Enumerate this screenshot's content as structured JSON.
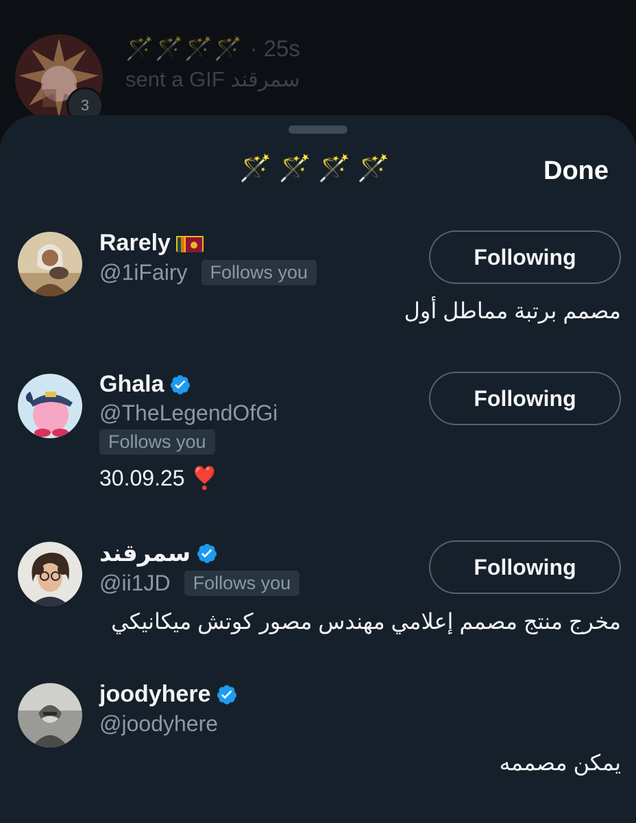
{
  "background_message": {
    "title_icons": "🪄🪄🪄🪄",
    "time": "· 25s",
    "subtitle": "sent a GIF سمرقند",
    "unread_count": "3"
  },
  "sheet": {
    "title": "🪄🪄🪄🪄",
    "done_label": "Done"
  },
  "users": [
    {
      "name": "Rarely",
      "flag_icon": "sri-lanka-flag-icon",
      "handle": "@1iFairy",
      "follows_you": "Follows you",
      "button": "Following",
      "bio": "مصمم برتبة مماطل أول"
    },
    {
      "name": "Ghala",
      "verified": true,
      "handle": "@TheLegendOfGi",
      "follows_you": "Follows you",
      "button": "Following",
      "bio": "30.09.25 ❣️"
    },
    {
      "name": "سمرقند",
      "verified": true,
      "handle": "@ii1JD",
      "follows_you": "Follows you",
      "button": "Following",
      "bio": "مخرج منتج مصمم إعلامي مهندس مصور كوتش ميكانيكي"
    },
    {
      "name": "joodyhere",
      "verified": true,
      "handle": "@joodyhere",
      "bio": "يمكن مصممه"
    }
  ],
  "colors": {
    "sheet_bg": "#16202a",
    "verified_blue": "#1d9bf0",
    "muted_text": "#8b98a5"
  }
}
